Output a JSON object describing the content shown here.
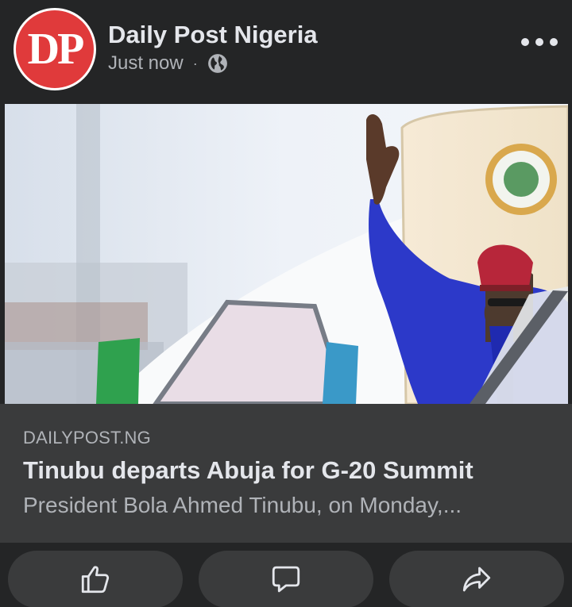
{
  "post": {
    "page_name": "Daily Post Nigeria",
    "avatar_text": "DP",
    "timestamp": "Just now",
    "separator": "·",
    "audience_icon": "globe-icon",
    "more_icon": "more-horizontal-icon"
  },
  "link_preview": {
    "domain": "DAILYPOST.NG",
    "title": "Tinubu departs Abuja for G-20 Summit",
    "description": "President Bola Ahmed Tinubu, on Monday,..."
  },
  "actions": [
    {
      "icon": "like-icon"
    },
    {
      "icon": "comment-icon"
    },
    {
      "icon": "share-icon"
    }
  ],
  "colors": {
    "background": "#242526",
    "card": "#3a3b3c",
    "avatar_red": "#e03a3b",
    "primary_text": "#e4e6eb",
    "secondary_text": "#b0b3b8"
  }
}
